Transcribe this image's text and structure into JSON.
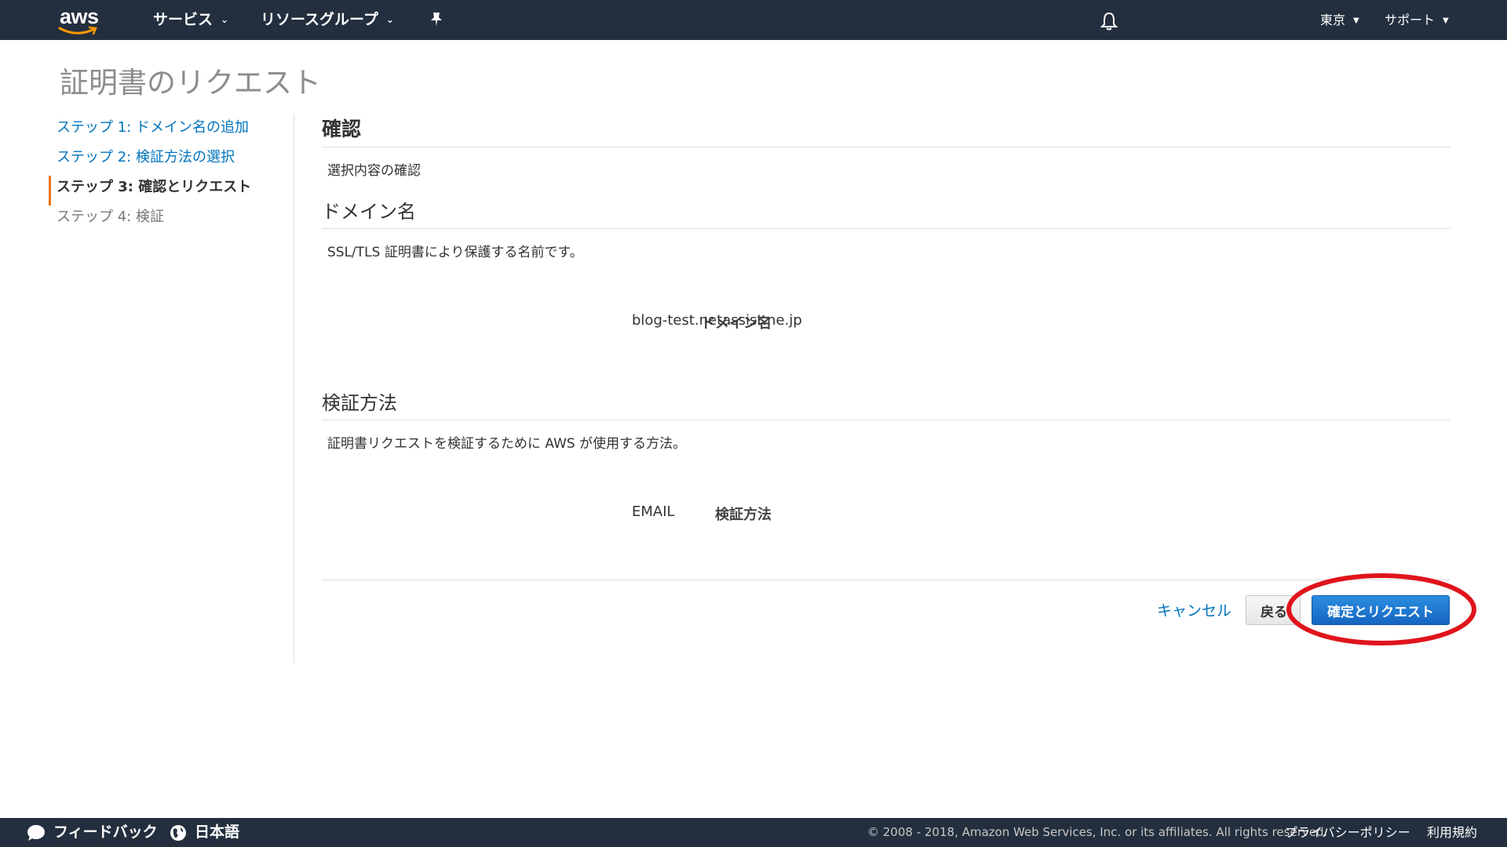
{
  "topnav": {
    "logo_text": "aws",
    "services": "サービス",
    "resource_groups": "リソースグループ",
    "region": "東京",
    "support": "サポート"
  },
  "page_title": "証明書のリクエスト",
  "steps": [
    {
      "label": "ステップ 1: ドメイン名の追加",
      "state": "link"
    },
    {
      "label": "ステップ 2: 検証方法の選択",
      "state": "link"
    },
    {
      "label": "ステップ 3: 確認とリクエスト",
      "state": "active"
    },
    {
      "label": "ステップ 4: 検証",
      "state": "disabled"
    }
  ],
  "review": {
    "title": "確認",
    "desc": "選択内容の確認"
  },
  "domain_section": {
    "title": "ドメイン名",
    "desc": "SSL/TLS 証明書により保護する名前です。",
    "label": "ドメイン名",
    "value": "blog-test.netassist.ne.jp"
  },
  "validation_section": {
    "title": "検証方法",
    "desc": "証明書リクエストを検証するために AWS が使用する方法。",
    "label": "検証方法",
    "value": "EMAIL"
  },
  "actions": {
    "cancel": "キャンセル",
    "back": "戻る",
    "confirm": "確定とリクエスト"
  },
  "footer": {
    "feedback": "フィードバック",
    "language": "日本語",
    "copyright": "© 2008 - 2018, Amazon Web Services, Inc. or its affiliates. All rights reserved.",
    "privacy": "プライバシーポリシー",
    "terms": "利用規約"
  },
  "colors": {
    "nav_bg": "#232f3e",
    "link": "#0073bb",
    "primary": "#1f7ad6",
    "active_marker": "#ec7211",
    "annotation": "#e0141c"
  }
}
